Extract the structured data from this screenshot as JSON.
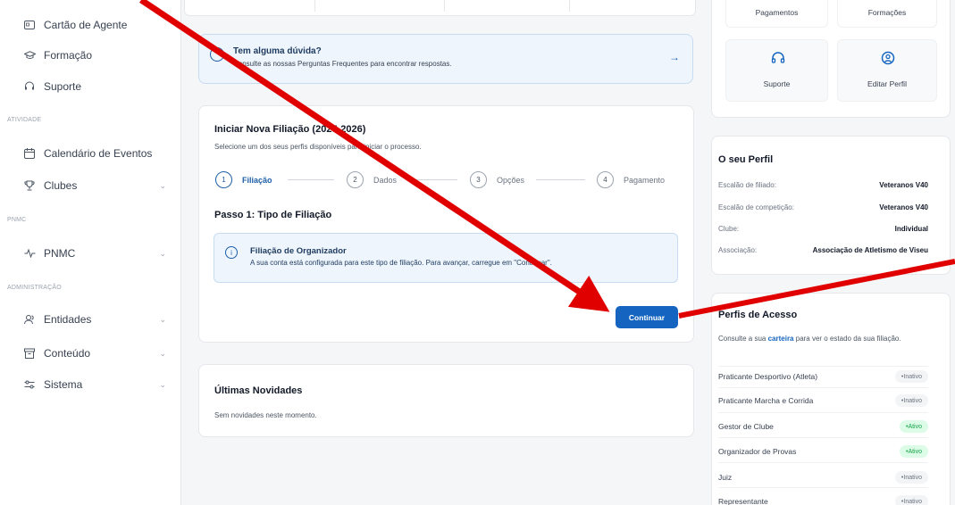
{
  "sidebar": {
    "items": [
      {
        "label": "Cartão de Agente",
        "icon": "id-card-icon"
      },
      {
        "label": "Formação",
        "icon": "graduation-cap-icon"
      },
      {
        "label": "Suporte",
        "icon": "headset-icon"
      },
      {
        "label": "Calendário de Eventos",
        "icon": "calendar-icon"
      },
      {
        "label": "Clubes",
        "icon": "trophy-icon"
      },
      {
        "label": "PNMC",
        "icon": "activity-icon"
      },
      {
        "label": "Entidades",
        "icon": "users-icon"
      },
      {
        "label": "Conteúdo",
        "icon": "archive-icon"
      },
      {
        "label": "Sistema",
        "icon": "sliders-icon"
      }
    ],
    "sections": {
      "atividade": "ATIVIDADE",
      "pnmc": "PNMC",
      "administracao": "ADMINISTRAÇÃO"
    }
  },
  "help": {
    "title": "Tem alguma dúvida?",
    "subtitle": "Consulte as nossas Perguntas Frequentes para encontrar respostas."
  },
  "filiacao": {
    "title": "Iniciar Nova Filiação (2025-2026)",
    "subtitle": "Selecione um dos seus perfis disponíveis para iniciar o processo.",
    "steps": [
      {
        "num": "1",
        "label": "Filiação"
      },
      {
        "num": "2",
        "label": "Dados"
      },
      {
        "num": "3",
        "label": "Opções"
      },
      {
        "num": "4",
        "label": "Pagamento"
      }
    ],
    "step_title": "Passo 1: Tipo de Filiação",
    "org_title": "Filiação de Organizador",
    "org_text": "A sua conta está configurada para este tipo de filiação. Para avançar, carregue em \"Continuar\".",
    "continue_label": "Continuar"
  },
  "news": {
    "title": "Últimas Novidades",
    "empty": "Sem novidades neste momento."
  },
  "quick": {
    "pagamentos": "Pagamentos",
    "formacoes": "Formações",
    "suporte": "Suporte",
    "editar": "Editar Perfil"
  },
  "perfil": {
    "title": "O seu Perfil",
    "rows": [
      {
        "label": "Escalão de filiado:",
        "value": "Veteranos V40"
      },
      {
        "label": "Escalão de competição:",
        "value": "Veteranos V40"
      },
      {
        "label": "Clube:",
        "value": "Individual"
      },
      {
        "label": "Associação:",
        "value": "Associação de Atletismo de Viseu"
      }
    ]
  },
  "acesso": {
    "title": "Perfis de Acesso",
    "desc_pre": "Consulte a sua ",
    "desc_link": "carteira",
    "desc_post": " para ver o estado da sua filiação.",
    "items": [
      {
        "name": "Praticante Desportivo (Atleta)",
        "status": "Inativo"
      },
      {
        "name": "Praticante Marcha e Corrida",
        "status": "Inativo"
      },
      {
        "name": "Gestor de Clube",
        "status": "Ativo"
      },
      {
        "name": "Organizador de Provas",
        "status": "Ativo"
      },
      {
        "name": "Juiz",
        "status": "Inativo"
      },
      {
        "name": "Representante",
        "status": "Inativo"
      }
    ]
  },
  "colors": {
    "primary": "#1565c0",
    "annotation": "#e00000",
    "active_badge": "#16a34a"
  }
}
